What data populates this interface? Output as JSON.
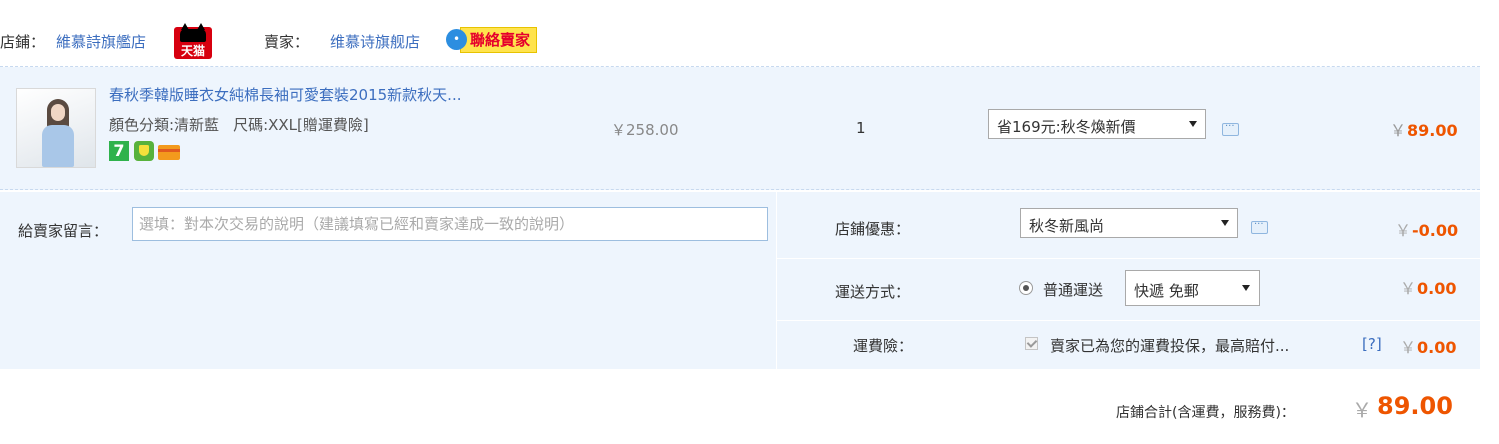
{
  "shop": {
    "label": "店鋪：",
    "name": "維慕詩旗艦店",
    "tmall_badge": "天猫",
    "seller_label": "賣家：",
    "seller_name": "维慕诗旗舰店",
    "contact_label": "聯絡賣家"
  },
  "item": {
    "title": "春秋季韓版睡衣女純棉長袖可愛套裝2015新款秋天...",
    "sku_color": "顏色分類:清新藍",
    "sku_size": "尺碼:XXL[贈運費險]",
    "service_icons": [
      "seven-day-return-icon",
      "guarantee-shield-icon",
      "credit-card-icon"
    ],
    "seven_label": "7",
    "unit_price": "￥258.00",
    "quantity": "1",
    "promo_selected": "省169元:秋冬煥新價",
    "total_currency": "￥",
    "total": "89.00"
  },
  "options": {
    "message_label": "給賣家留言：",
    "message_placeholder": "選填：對本次交易的說明（建議填寫已經和賣家達成一致的說明）",
    "shop_discount_label": "店鋪優惠：",
    "shop_discount_selected": "秋冬新風尚",
    "shop_discount_currency": "￥",
    "shop_discount_amount": "-0.00",
    "shipping_label": "運送方式：",
    "shipping_radio_label": "普通運送",
    "shipping_selected": "快遞 免郵",
    "shipping_currency": "￥",
    "shipping_amount": "0.00",
    "insurance_label": "運費險：",
    "insurance_text": "賣家已為您的運費投保，最高賠付...",
    "insurance_help": "[?]",
    "insurance_currency": "￥",
    "insurance_amount": "0.00"
  },
  "footer": {
    "total_label": "店鋪合計(含運費，服務費)：",
    "total_currency": "￥",
    "total_amount": "89.00"
  },
  "colors": {
    "accent_orange": "#ee5500",
    "link_blue": "#3c6ebf",
    "panel_bg": "#eef5fd",
    "tmall_red": "#d7000f"
  }
}
